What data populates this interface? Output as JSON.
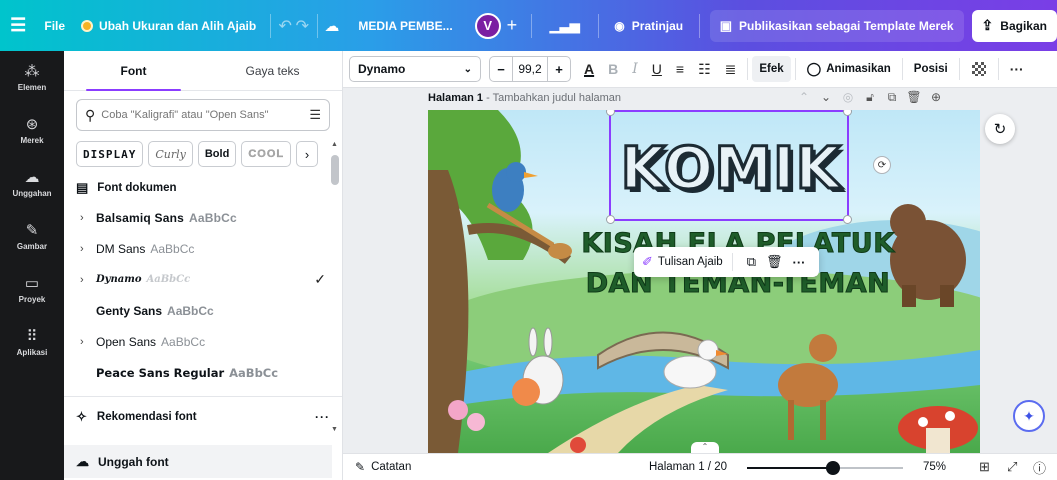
{
  "topbar": {
    "file": "File",
    "doc_menu": "Ubah Ukuran dan Alih Ajaib",
    "doc_title": "MEDIA PEMBE...",
    "avatar_initial": "V",
    "preview": "Pratinjau",
    "publish": "Publikasikan sebagai Template Merek",
    "share": "Bagikan"
  },
  "rail": {
    "items": [
      {
        "label": "Elemen",
        "icon": "shapes-icon"
      },
      {
        "label": "Merek",
        "icon": "brand-icon"
      },
      {
        "label": "Unggahan",
        "icon": "upload-cloud-icon"
      },
      {
        "label": "Gambar",
        "icon": "draw-icon"
      },
      {
        "label": "Proyek",
        "icon": "folder-icon"
      },
      {
        "label": "Aplikasi",
        "icon": "apps-grid-icon"
      }
    ]
  },
  "panel": {
    "tabs": [
      "Font",
      "Gaya teks"
    ],
    "search_placeholder": "Coba \"Kaligrafi\" atau \"Open Sans\"",
    "style_chips": [
      "DISPLAY",
      "Curly",
      "Bold",
      "COOL"
    ],
    "section_title": "Font dokumen",
    "fonts": [
      {
        "name": "Balsamiq Sans",
        "sample": "AaBbCc",
        "expandable": true,
        "selected": false
      },
      {
        "name": "DM Sans",
        "sample": "AaBbCc",
        "expandable": true,
        "selected": false
      },
      {
        "name": "Dynamo",
        "sample": "AaBbCc",
        "expandable": true,
        "selected": true
      },
      {
        "name": "Genty Sans",
        "sample": "AaBbCc",
        "expandable": false,
        "selected": false
      },
      {
        "name": "Open Sans",
        "sample": "AaBbCc",
        "expandable": true,
        "selected": false
      },
      {
        "name": "Peace Sans Regular",
        "sample": "AaBbCc",
        "expandable": false,
        "selected": false
      }
    ],
    "recommend": "Rekomendasi font",
    "upload": "Unggah font"
  },
  "toolbar": {
    "font_name": "Dynamo",
    "font_size": "99,2",
    "effects": "Efek",
    "animate": "Animasikan",
    "position": "Posisi"
  },
  "canvas": {
    "page_title": "Halaman 1",
    "page_subtitle": " - Tambahkan judul halaman",
    "title_text": "KOMIK",
    "subtitle_line1": "KISAH ELA PELATUK",
    "subtitle_line2": "DAN TEMAN-TEMAN",
    "context_action": "Tulisan Ajaib"
  },
  "bottombar": {
    "notes": "Catatan",
    "page_indicator": "Halaman 1 / 20",
    "zoom": "75%",
    "zoom_fraction": 0.55
  },
  "colors": {
    "accent": "#8b3dff",
    "rail_bg": "#18191b",
    "title_text": "#e8f2f7",
    "subtitle_text": "#1f5d2a"
  }
}
